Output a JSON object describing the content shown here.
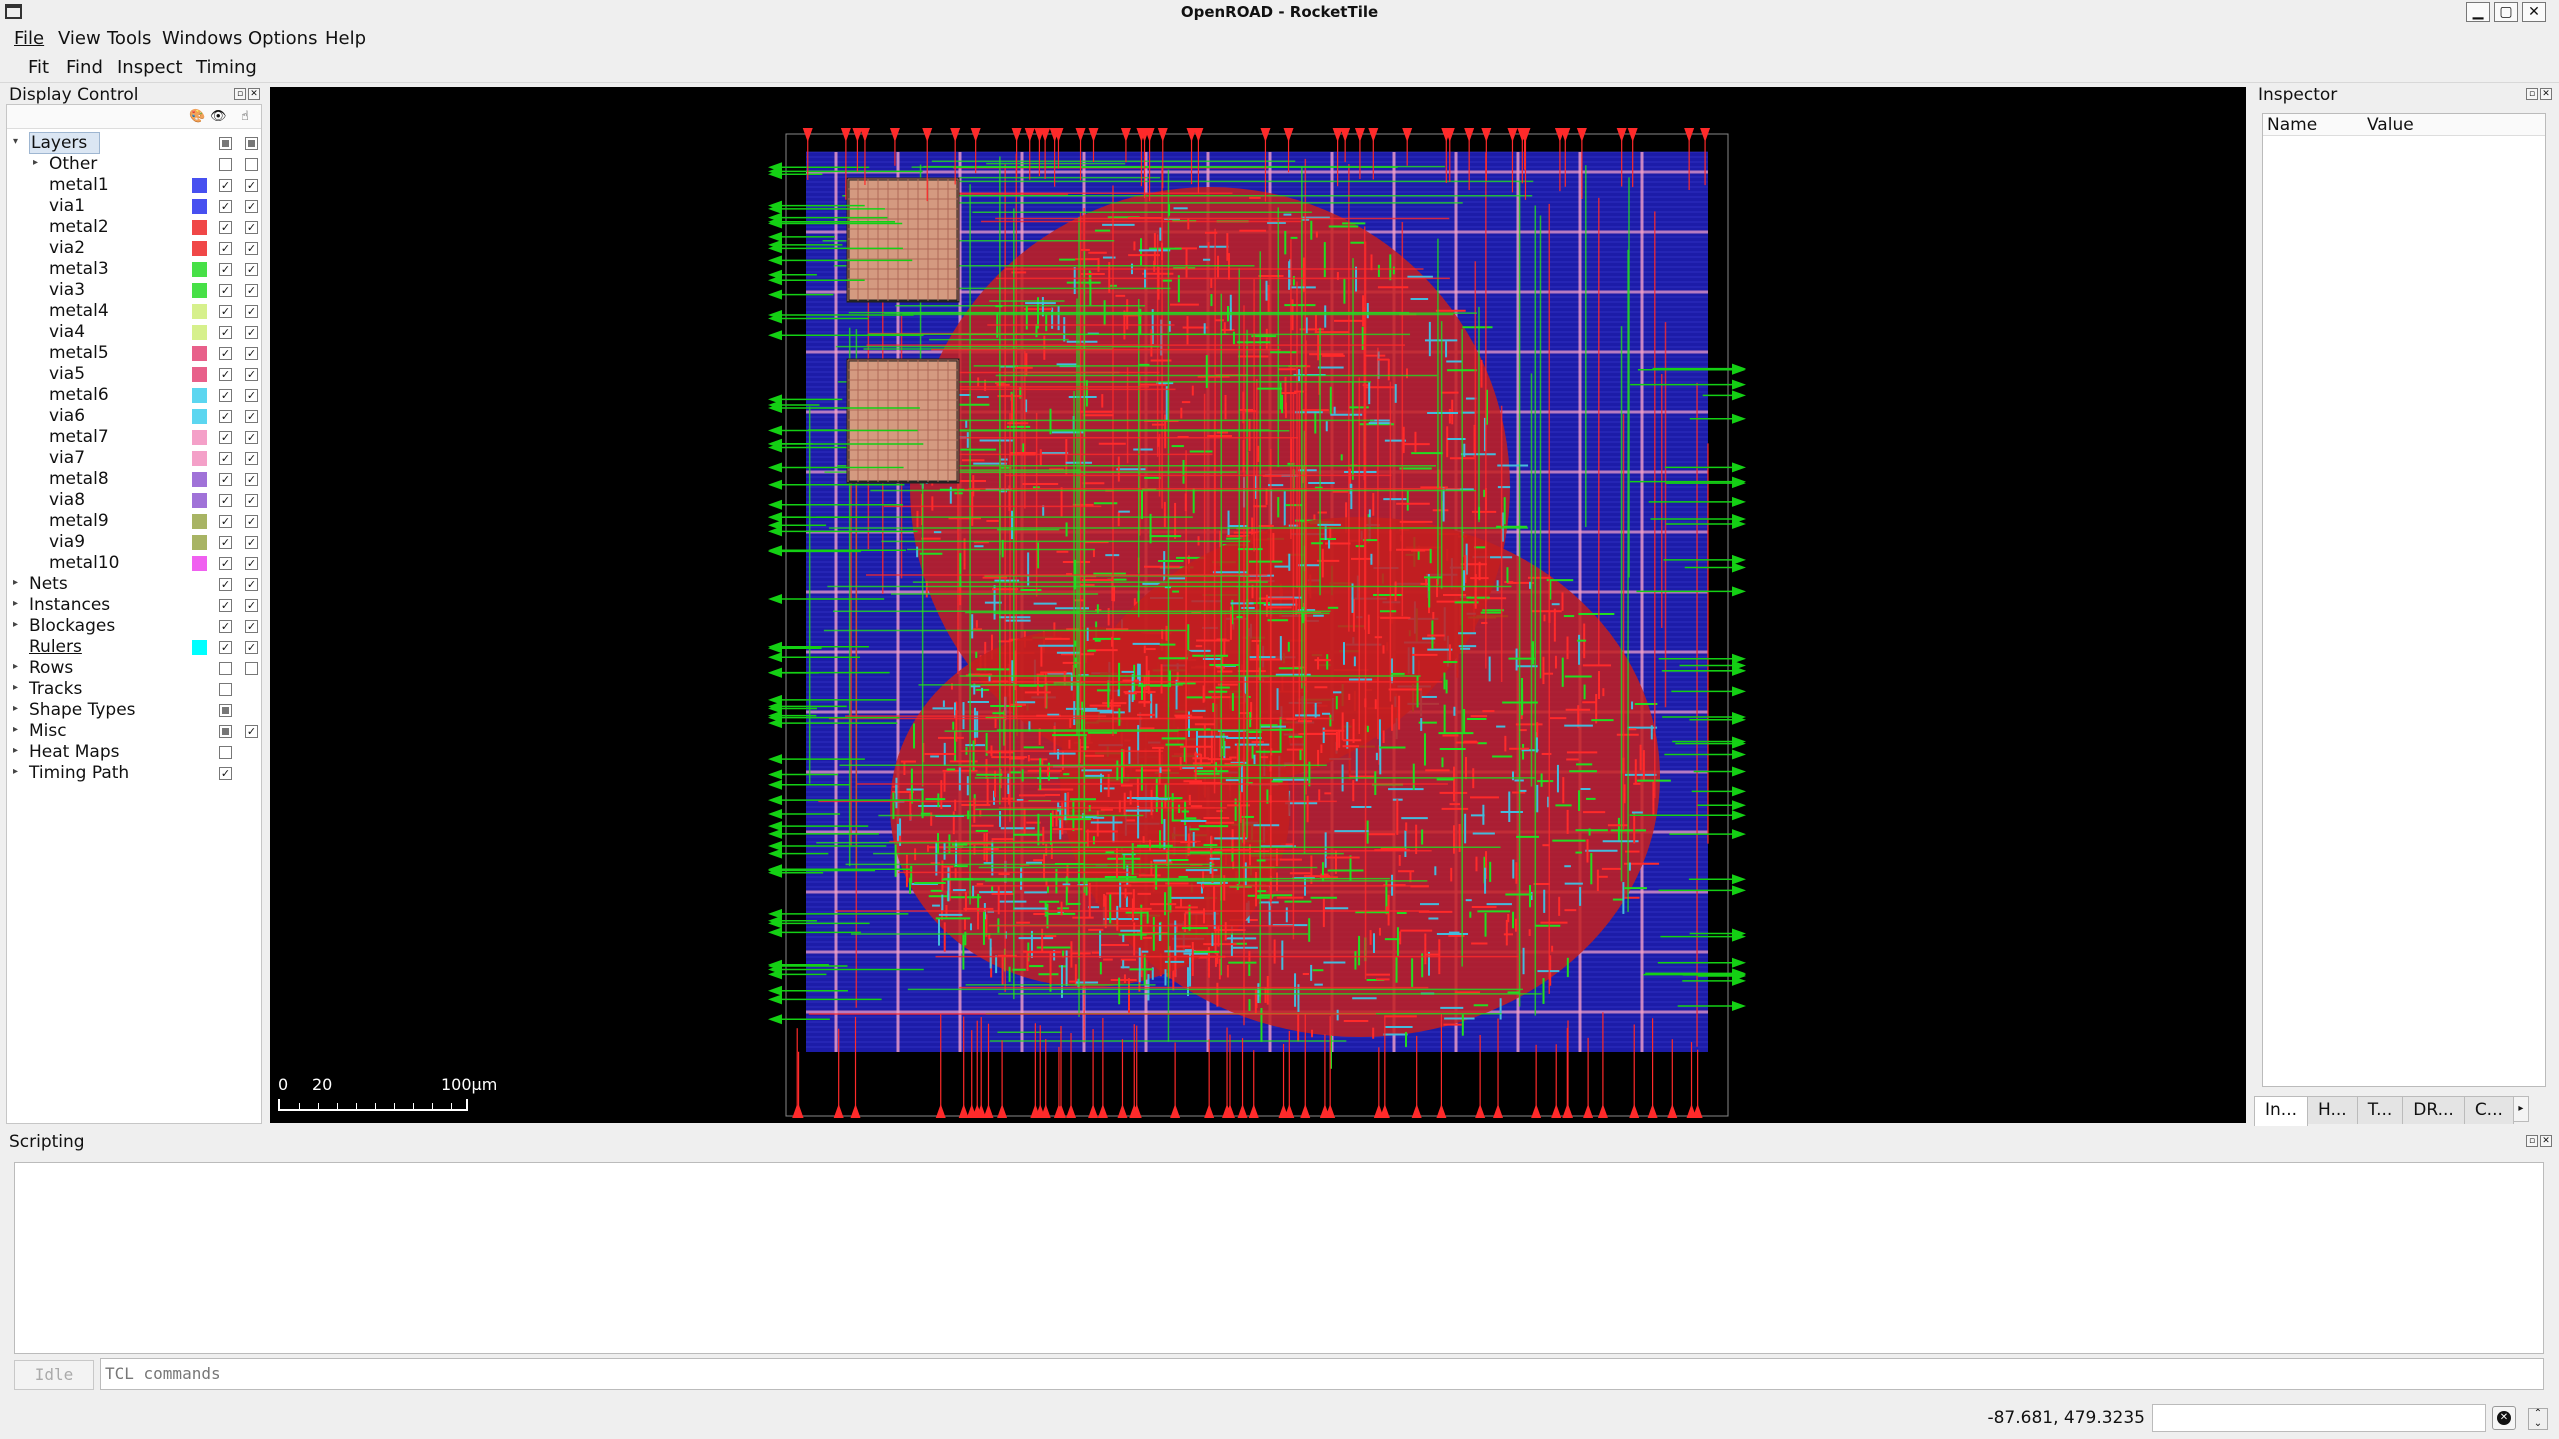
{
  "window": {
    "title": "OpenROAD - RocketTile"
  },
  "menus": [
    "File",
    "View",
    "Tools",
    "Windows",
    "Options",
    "Help"
  ],
  "toolbar": [
    "Fit",
    "Find",
    "Inspect",
    "Timing"
  ],
  "display_control": {
    "title": "Display Control",
    "header_icons": [
      "palette-icon",
      "eye-icon",
      "pointer-icon"
    ],
    "rows": [
      {
        "label": "Layers",
        "indent": 1,
        "expanded": true,
        "selected": true,
        "vis": "partial",
        "sel": "partial"
      },
      {
        "label": "Other",
        "indent": 2,
        "expanded": false,
        "vis": "off",
        "sel": "off"
      },
      {
        "label": "metal1",
        "indent": 2,
        "color": "#4750f0",
        "vis": "on",
        "sel": "on"
      },
      {
        "label": "via1",
        "indent": 2,
        "color": "#4750f0",
        "vis": "on",
        "sel": "on"
      },
      {
        "label": "metal2",
        "indent": 2,
        "color": "#f04747",
        "vis": "on",
        "sel": "on"
      },
      {
        "label": "via2",
        "indent": 2,
        "color": "#f04747",
        "vis": "on",
        "sel": "on"
      },
      {
        "label": "metal3",
        "indent": 2,
        "color": "#47e047",
        "vis": "on",
        "sel": "on"
      },
      {
        "label": "via3",
        "indent": 2,
        "color": "#47e047",
        "vis": "on",
        "sel": "on"
      },
      {
        "label": "metal4",
        "indent": 2,
        "color": "#d6f08c",
        "vis": "on",
        "sel": "on"
      },
      {
        "label": "via4",
        "indent": 2,
        "color": "#d6f08c",
        "vis": "on",
        "sel": "on"
      },
      {
        "label": "metal5",
        "indent": 2,
        "color": "#e8608a",
        "vis": "on",
        "sel": "on"
      },
      {
        "label": "via5",
        "indent": 2,
        "color": "#e8608a",
        "vis": "on",
        "sel": "on"
      },
      {
        "label": "metal6",
        "indent": 2,
        "color": "#5cd6f0",
        "vis": "on",
        "sel": "on"
      },
      {
        "label": "via6",
        "indent": 2,
        "color": "#5cd6f0",
        "vis": "on",
        "sel": "on"
      },
      {
        "label": "metal7",
        "indent": 2,
        "color": "#f4a0c8",
        "vis": "on",
        "sel": "on"
      },
      {
        "label": "via7",
        "indent": 2,
        "color": "#f4a0c8",
        "vis": "on",
        "sel": "on"
      },
      {
        "label": "metal8",
        "indent": 2,
        "color": "#a072d8",
        "vis": "on",
        "sel": "on"
      },
      {
        "label": "via8",
        "indent": 2,
        "color": "#a072d8",
        "vis": "on",
        "sel": "on"
      },
      {
        "label": "metal9",
        "indent": 2,
        "color": "#a8b464",
        "vis": "on",
        "sel": "on"
      },
      {
        "label": "via9",
        "indent": 2,
        "color": "#a8b464",
        "vis": "on",
        "sel": "on"
      },
      {
        "label": "metal10",
        "indent": 2,
        "color": "#f060f0",
        "vis": "on",
        "sel": "on"
      },
      {
        "label": "Nets",
        "indent": 1,
        "expanded": false,
        "vis": "on",
        "sel": "on"
      },
      {
        "label": "Instances",
        "indent": 1,
        "expanded": false,
        "vis": "on",
        "sel": "on"
      },
      {
        "label": "Blockages",
        "indent": 1,
        "expanded": false,
        "vis": "on",
        "sel": "on"
      },
      {
        "label": "Rulers",
        "indent": 1,
        "link": true,
        "color": "#00ffff",
        "vis": "on",
        "sel": "on"
      },
      {
        "label": "Rows",
        "indent": 1,
        "expanded": false,
        "vis": "off",
        "sel": "off"
      },
      {
        "label": "Tracks",
        "indent": 1,
        "expanded": false,
        "vis": "off"
      },
      {
        "label": "Shape Types",
        "indent": 1,
        "expanded": false,
        "vis": "partial"
      },
      {
        "label": "Misc",
        "indent": 1,
        "expanded": false,
        "vis": "partial",
        "sel": "on"
      },
      {
        "label": "Heat Maps",
        "indent": 1,
        "expanded": false,
        "vis": "off"
      },
      {
        "label": "Timing Path",
        "indent": 1,
        "expanded": false,
        "vis": "on"
      }
    ]
  },
  "layout_view": {
    "scale_labels": [
      "0",
      "20",
      "100µm"
    ],
    "colors": {
      "background": "#000000",
      "rows": "#1c1ca8",
      "routes_red": "#ff2a2a",
      "routes_green": "#22dd22",
      "routes_cyan": "#44bbdd",
      "pins": "#14d014",
      "macro": "#d49a80"
    }
  },
  "inspector": {
    "title": "Inspector",
    "columns": [
      "Name",
      "Value"
    ],
    "tabs": [
      "In...",
      "H...",
      "T...",
      "DR...",
      "C..."
    ],
    "active_tab": 0
  },
  "scripting": {
    "title": "Scripting",
    "idle_label": "Idle",
    "placeholder": "TCL commands"
  },
  "status": {
    "coords": "-87.681, 479.3235"
  }
}
